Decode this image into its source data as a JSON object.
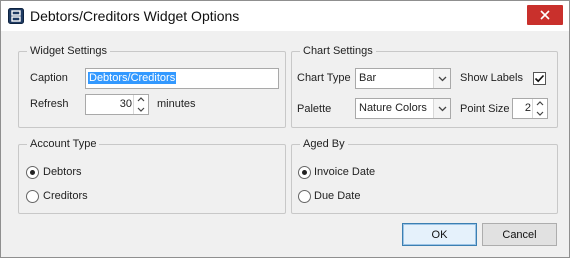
{
  "window": {
    "title": "Debtors/Creditors Widget Options"
  },
  "widget_settings": {
    "legend": "Widget Settings",
    "caption_label": "Caption",
    "caption_value": "Debtors/Creditors",
    "refresh_label": "Refresh",
    "refresh_value": "30",
    "refresh_unit": "minutes"
  },
  "chart_settings": {
    "legend": "Chart Settings",
    "chart_type_label": "Chart Type",
    "chart_type_value": "Bar",
    "show_labels_label": "Show Labels",
    "show_labels_checked": true,
    "palette_label": "Palette",
    "palette_value": "Nature Colors",
    "point_size_label": "Point Size",
    "point_size_value": "2"
  },
  "account_type": {
    "legend": "Account Type",
    "options": [
      "Debtors",
      "Creditors"
    ],
    "selected": "Debtors"
  },
  "aged_by": {
    "legend": "Aged By",
    "options": [
      "Invoice Date",
      "Due Date"
    ],
    "selected": "Invoice Date"
  },
  "buttons": {
    "ok": "OK",
    "cancel": "Cancel"
  },
  "colors": {
    "close_button": "#c9302c",
    "selection": "#3399ff"
  }
}
